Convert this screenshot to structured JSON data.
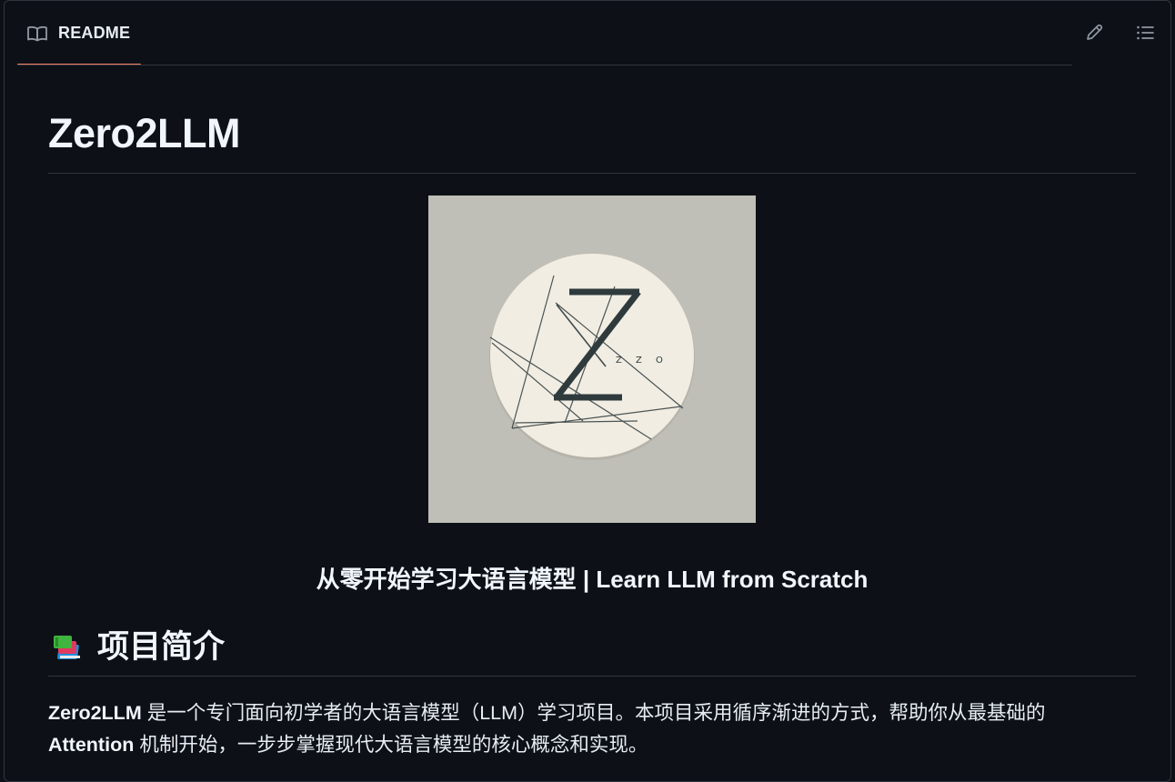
{
  "tab": {
    "label": "README",
    "icon": "book-icon"
  },
  "toolbar": {
    "edit_icon": "pencil-icon",
    "toc_icon": "list-unordered-icon"
  },
  "readme": {
    "title": "Zero2LLM",
    "logo": {
      "letter": "Z",
      "small_text": "Z  Z  O",
      "background": "#bfbfb8",
      "circle": "#f1ede2",
      "ink": "#2f3a3d"
    },
    "tagline": "从零开始学习大语言模型 | Learn LLM from Scratch",
    "section": {
      "emoji_icon": "books-icon",
      "heading": "项目简介"
    },
    "intro": {
      "bold_lead": "Zero2LLM",
      "part1": " 是一个专门面向初学者的大语言模型（LLM）学习项目。本项目采用循序渐进的方式，帮助你从最基础的",
      "bold_mid": "Attention",
      "part2": " 机制开始，一步步掌握现代大语言模型的核心概念和实现。"
    }
  },
  "colors": {
    "background": "#0d1117",
    "border": "#30363d",
    "tab_accent": "#f78166",
    "text": "#e6edf3"
  }
}
